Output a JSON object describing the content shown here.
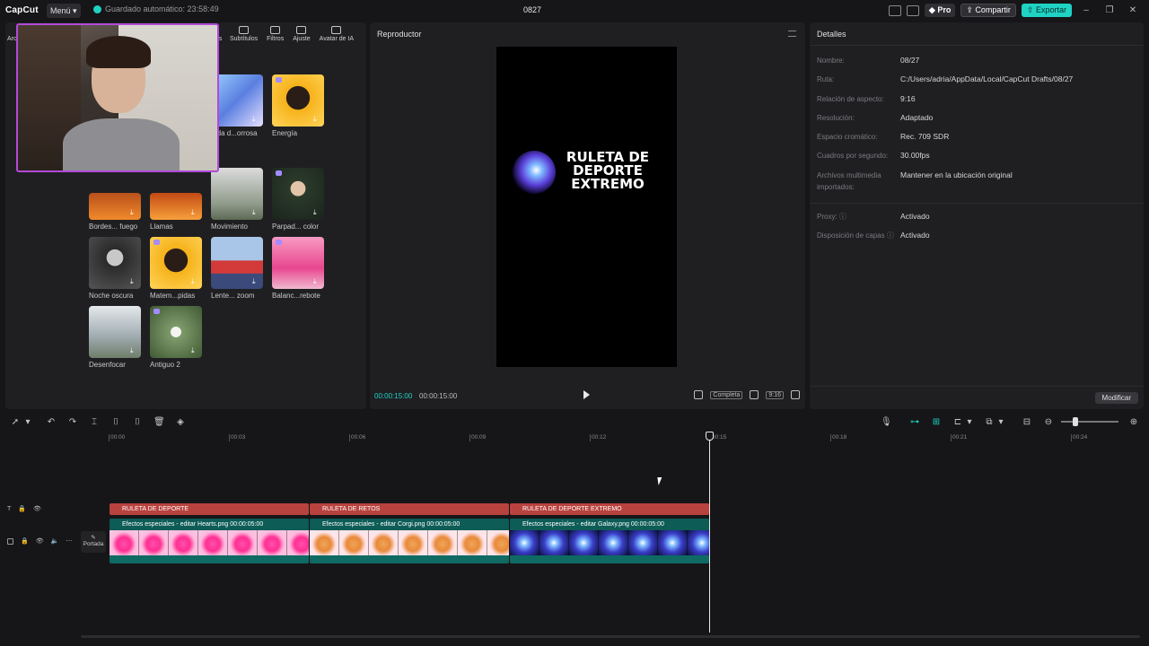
{
  "app": {
    "logo": "CapCut",
    "menu_label": "Menú",
    "autosave": "Guardado automático: 23:58:49",
    "project_title": "0827",
    "pro_label": "Pro",
    "share_label": "Compartir",
    "export_label": "Exportar",
    "accent_color": "#1fd3c4"
  },
  "left_panel": {
    "side_label": "Arc",
    "cut_label": "es",
    "tabs": [
      {
        "label": "Subtítulos",
        "icon": "subtitles-icon"
      },
      {
        "label": "Filtros",
        "icon": "filters-icon"
      },
      {
        "label": "Ajuste",
        "icon": "adjust-icon"
      },
      {
        "label": "Avatar de IA",
        "icon": "ai-avatar-icon"
      }
    ],
    "effects": [
      {
        "name": "...da d...orrosa"
      },
      {
        "name": "Energía"
      },
      {
        "name": "Bordes... fuego"
      },
      {
        "name": "Llamas"
      },
      {
        "name": "Movimiento"
      },
      {
        "name": "Parpad... color"
      },
      {
        "name": "Noche oscura"
      },
      {
        "name": "Matem...pidas"
      },
      {
        "name": "Lente... zoom"
      },
      {
        "name": "Balanc...rebote"
      },
      {
        "name": "Desenfocar"
      },
      {
        "name": "Antiguo 2"
      }
    ]
  },
  "player": {
    "title": "Reproductor",
    "canvas_text": "RULETA DE DEPORTE EXTREMO",
    "current_time": "00:00:15:00",
    "total_time": "00:00:15:00",
    "full_label": "Completa",
    "ratio_label": "9:16"
  },
  "details": {
    "title": "Detalles",
    "rows": [
      {
        "k": "Nombre:",
        "v": "08/27"
      },
      {
        "k": "Ruta:",
        "v": "C:/Users/adria/AppData/Local/CapCut Drafts/08/27"
      },
      {
        "k": "Relación de aspecto:",
        "v": "9:16"
      },
      {
        "k": "Resolución:",
        "v": "Adaptado"
      },
      {
        "k": "Espacio cromático:",
        "v": "Rec. 709 SDR"
      },
      {
        "k": "Cuadros por segundo:",
        "v": "30.00fps"
      },
      {
        "k": "Archivos multimedia importados:",
        "v": "Mantener en la ubicación original"
      },
      {
        "k": "Proxy:",
        "v": "Activado"
      },
      {
        "k": "Disposición de capas",
        "v": "Activado"
      }
    ],
    "modify_label": "Modificar"
  },
  "timeline": {
    "ticks": [
      "00:00",
      "00:03",
      "00:06",
      "00:09",
      "00:12",
      "00:15",
      "00:18",
      "00:21",
      "00:24"
    ],
    "cover_label": "Portada",
    "text_clips": [
      "RULETA DE DEPORTE",
      "RULETA DE RETOS",
      "RULETA DE DEPORTE  EXTREMO"
    ],
    "video_clips": [
      {
        "label": "Efectos especiales - editar  Hearts.png  00:00:05:00"
      },
      {
        "label": "Efectos especiales - editar  Corgi.png  00:00:05:00"
      },
      {
        "label": "Efectos especiales - editar  Galaxy.png  00:00:05:00"
      }
    ]
  }
}
